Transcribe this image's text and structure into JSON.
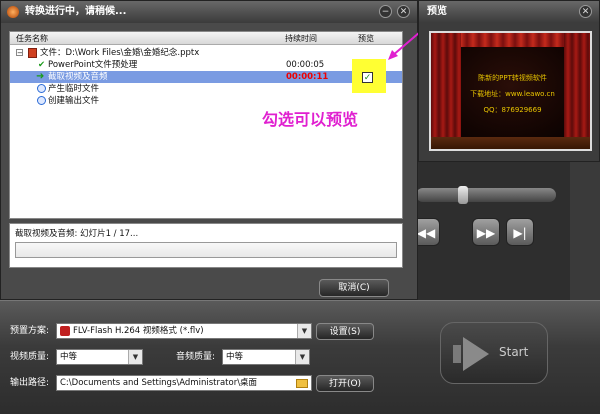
{
  "dialog": {
    "title": "转换进行中，请稍候...",
    "min_btn": "−",
    "close_btn": "✕",
    "columns": {
      "task": "任务名称",
      "duration": "持续时间",
      "preview": "预览"
    },
    "tree": {
      "collapse_glyph": "−",
      "file_label": "文件：D:\\Work Files\\金婚\\金婚纪念.pptx",
      "items": [
        {
          "label": "PowerPoint文件预处理",
          "time": "00:00:05",
          "icon": "check-icon"
        },
        {
          "label": "截取视频及音频",
          "time": "00:00:11",
          "icon": "arrow-icon",
          "preview_checked": true
        },
        {
          "label": "产生临时文件",
          "time": "",
          "icon": "clock-icon"
        },
        {
          "label": "创建输出文件",
          "time": "",
          "icon": "clock-icon"
        }
      ]
    },
    "status_text": "截取视频及音频: 幻灯片1 / 17...",
    "cancel_button": "取消(C)",
    "annotation": "勾选可以预览",
    "checkmark": "✓"
  },
  "preview": {
    "title": "预览",
    "close_btn": "✕",
    "stage_line1": "陈新的PPT转视频软件",
    "stage_line2": "下载地址：www.leawo.cn",
    "stage_line3": "QQ：876929669"
  },
  "settings": {
    "profile_label": "预置方案:",
    "profile_value": "FLV-Flash H.264 视频格式 (*.flv)",
    "settings_button": "设置(S)",
    "video_quality_label": "视频质量:",
    "video_quality_value": "中等",
    "audio_quality_label": "音频质量:",
    "audio_quality_value": "中等",
    "output_label": "输出路径:",
    "output_value": "C:\\Documents and Settings\\Administrator\\桌面",
    "open_button": "打开(O)",
    "start_label": "Start"
  },
  "colors": {
    "accent": "#7a9be2",
    "annotation": "#e020d0",
    "running_time": "#e00000",
    "highlight": "#ffff33"
  }
}
